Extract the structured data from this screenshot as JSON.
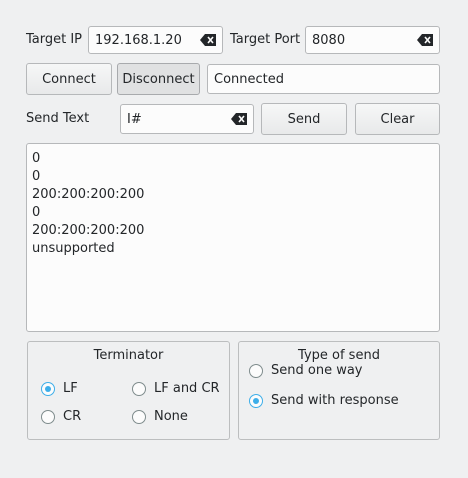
{
  "connection": {
    "target_ip_label": "Target IP",
    "target_ip_value": "192.168.1.20",
    "target_port_label": "Target Port",
    "target_port_value": "8080",
    "connect_label": "Connect",
    "disconnect_label": "Disconnect",
    "status_text": "Connected"
  },
  "send": {
    "send_text_label": "Send Text",
    "send_text_value": "I#",
    "send_button_label": "Send",
    "clear_button_label": "Clear"
  },
  "output": {
    "lines": [
      "0",
      "0",
      "200:200:200:200",
      "0",
      "200:200:200:200",
      "unsupported"
    ]
  },
  "terminator": {
    "title": "Terminator",
    "options": [
      "LF",
      "LF and CR",
      "CR",
      "None"
    ],
    "selected": "LF"
  },
  "send_type": {
    "title": "Type of send",
    "options": [
      "Send one way",
      "Send with response"
    ],
    "selected": "Send with response"
  },
  "colors": {
    "accent": "#3daee9",
    "window_bg": "#eff0f1",
    "field_bg": "#fcfcfc"
  }
}
